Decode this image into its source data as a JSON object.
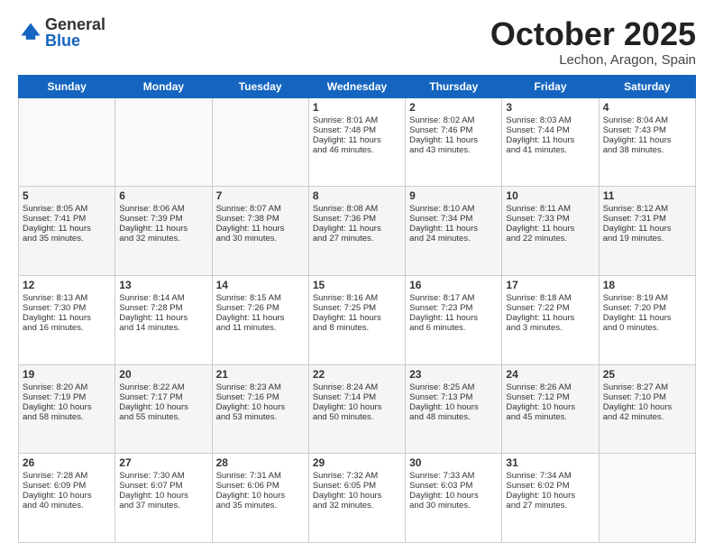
{
  "logo": {
    "general": "General",
    "blue": "Blue"
  },
  "title": "October 2025",
  "location": "Lechon, Aragon, Spain",
  "days_header": [
    "Sunday",
    "Monday",
    "Tuesday",
    "Wednesday",
    "Thursday",
    "Friday",
    "Saturday"
  ],
  "weeks": [
    [
      {
        "day": "",
        "info": ""
      },
      {
        "day": "",
        "info": ""
      },
      {
        "day": "",
        "info": ""
      },
      {
        "day": "1",
        "info": "Sunrise: 8:01 AM\nSunset: 7:48 PM\nDaylight: 11 hours\nand 46 minutes."
      },
      {
        "day": "2",
        "info": "Sunrise: 8:02 AM\nSunset: 7:46 PM\nDaylight: 11 hours\nand 43 minutes."
      },
      {
        "day": "3",
        "info": "Sunrise: 8:03 AM\nSunset: 7:44 PM\nDaylight: 11 hours\nand 41 minutes."
      },
      {
        "day": "4",
        "info": "Sunrise: 8:04 AM\nSunset: 7:43 PM\nDaylight: 11 hours\nand 38 minutes."
      }
    ],
    [
      {
        "day": "5",
        "info": "Sunrise: 8:05 AM\nSunset: 7:41 PM\nDaylight: 11 hours\nand 35 minutes."
      },
      {
        "day": "6",
        "info": "Sunrise: 8:06 AM\nSunset: 7:39 PM\nDaylight: 11 hours\nand 32 minutes."
      },
      {
        "day": "7",
        "info": "Sunrise: 8:07 AM\nSunset: 7:38 PM\nDaylight: 11 hours\nand 30 minutes."
      },
      {
        "day": "8",
        "info": "Sunrise: 8:08 AM\nSunset: 7:36 PM\nDaylight: 11 hours\nand 27 minutes."
      },
      {
        "day": "9",
        "info": "Sunrise: 8:10 AM\nSunset: 7:34 PM\nDaylight: 11 hours\nand 24 minutes."
      },
      {
        "day": "10",
        "info": "Sunrise: 8:11 AM\nSunset: 7:33 PM\nDaylight: 11 hours\nand 22 minutes."
      },
      {
        "day": "11",
        "info": "Sunrise: 8:12 AM\nSunset: 7:31 PM\nDaylight: 11 hours\nand 19 minutes."
      }
    ],
    [
      {
        "day": "12",
        "info": "Sunrise: 8:13 AM\nSunset: 7:30 PM\nDaylight: 11 hours\nand 16 minutes."
      },
      {
        "day": "13",
        "info": "Sunrise: 8:14 AM\nSunset: 7:28 PM\nDaylight: 11 hours\nand 14 minutes."
      },
      {
        "day": "14",
        "info": "Sunrise: 8:15 AM\nSunset: 7:26 PM\nDaylight: 11 hours\nand 11 minutes."
      },
      {
        "day": "15",
        "info": "Sunrise: 8:16 AM\nSunset: 7:25 PM\nDaylight: 11 hours\nand 8 minutes."
      },
      {
        "day": "16",
        "info": "Sunrise: 8:17 AM\nSunset: 7:23 PM\nDaylight: 11 hours\nand 6 minutes."
      },
      {
        "day": "17",
        "info": "Sunrise: 8:18 AM\nSunset: 7:22 PM\nDaylight: 11 hours\nand 3 minutes."
      },
      {
        "day": "18",
        "info": "Sunrise: 8:19 AM\nSunset: 7:20 PM\nDaylight: 11 hours\nand 0 minutes."
      }
    ],
    [
      {
        "day": "19",
        "info": "Sunrise: 8:20 AM\nSunset: 7:19 PM\nDaylight: 10 hours\nand 58 minutes."
      },
      {
        "day": "20",
        "info": "Sunrise: 8:22 AM\nSunset: 7:17 PM\nDaylight: 10 hours\nand 55 minutes."
      },
      {
        "day": "21",
        "info": "Sunrise: 8:23 AM\nSunset: 7:16 PM\nDaylight: 10 hours\nand 53 minutes."
      },
      {
        "day": "22",
        "info": "Sunrise: 8:24 AM\nSunset: 7:14 PM\nDaylight: 10 hours\nand 50 minutes."
      },
      {
        "day": "23",
        "info": "Sunrise: 8:25 AM\nSunset: 7:13 PM\nDaylight: 10 hours\nand 48 minutes."
      },
      {
        "day": "24",
        "info": "Sunrise: 8:26 AM\nSunset: 7:12 PM\nDaylight: 10 hours\nand 45 minutes."
      },
      {
        "day": "25",
        "info": "Sunrise: 8:27 AM\nSunset: 7:10 PM\nDaylight: 10 hours\nand 42 minutes."
      }
    ],
    [
      {
        "day": "26",
        "info": "Sunrise: 7:28 AM\nSunset: 6:09 PM\nDaylight: 10 hours\nand 40 minutes."
      },
      {
        "day": "27",
        "info": "Sunrise: 7:30 AM\nSunset: 6:07 PM\nDaylight: 10 hours\nand 37 minutes."
      },
      {
        "day": "28",
        "info": "Sunrise: 7:31 AM\nSunset: 6:06 PM\nDaylight: 10 hours\nand 35 minutes."
      },
      {
        "day": "29",
        "info": "Sunrise: 7:32 AM\nSunset: 6:05 PM\nDaylight: 10 hours\nand 32 minutes."
      },
      {
        "day": "30",
        "info": "Sunrise: 7:33 AM\nSunset: 6:03 PM\nDaylight: 10 hours\nand 30 minutes."
      },
      {
        "day": "31",
        "info": "Sunrise: 7:34 AM\nSunset: 6:02 PM\nDaylight: 10 hours\nand 27 minutes."
      },
      {
        "day": "",
        "info": ""
      }
    ]
  ]
}
